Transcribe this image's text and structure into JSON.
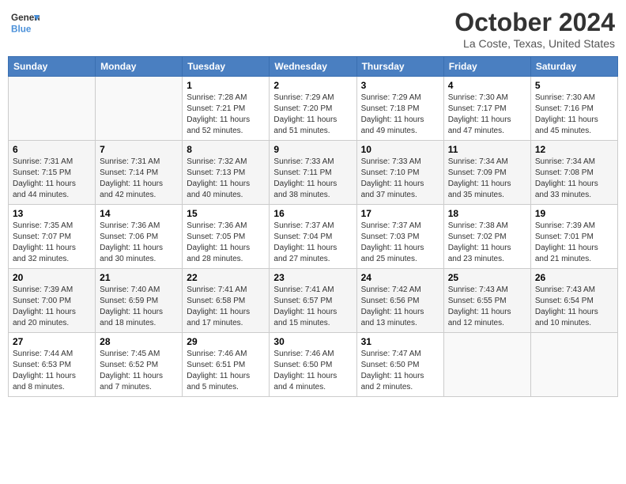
{
  "header": {
    "logo_line1": "General",
    "logo_line2": "Blue",
    "title": "October 2024",
    "subtitle": "La Coste, Texas, United States"
  },
  "days_of_week": [
    "Sunday",
    "Monday",
    "Tuesday",
    "Wednesday",
    "Thursday",
    "Friday",
    "Saturday"
  ],
  "weeks": [
    [
      {
        "day": "",
        "info": ""
      },
      {
        "day": "",
        "info": ""
      },
      {
        "day": "1",
        "info": "Sunrise: 7:28 AM\nSunset: 7:21 PM\nDaylight: 11 hours and 52 minutes."
      },
      {
        "day": "2",
        "info": "Sunrise: 7:29 AM\nSunset: 7:20 PM\nDaylight: 11 hours and 51 minutes."
      },
      {
        "day": "3",
        "info": "Sunrise: 7:29 AM\nSunset: 7:18 PM\nDaylight: 11 hours and 49 minutes."
      },
      {
        "day": "4",
        "info": "Sunrise: 7:30 AM\nSunset: 7:17 PM\nDaylight: 11 hours and 47 minutes."
      },
      {
        "day": "5",
        "info": "Sunrise: 7:30 AM\nSunset: 7:16 PM\nDaylight: 11 hours and 45 minutes."
      }
    ],
    [
      {
        "day": "6",
        "info": "Sunrise: 7:31 AM\nSunset: 7:15 PM\nDaylight: 11 hours and 44 minutes."
      },
      {
        "day": "7",
        "info": "Sunrise: 7:31 AM\nSunset: 7:14 PM\nDaylight: 11 hours and 42 minutes."
      },
      {
        "day": "8",
        "info": "Sunrise: 7:32 AM\nSunset: 7:13 PM\nDaylight: 11 hours and 40 minutes."
      },
      {
        "day": "9",
        "info": "Sunrise: 7:33 AM\nSunset: 7:11 PM\nDaylight: 11 hours and 38 minutes."
      },
      {
        "day": "10",
        "info": "Sunrise: 7:33 AM\nSunset: 7:10 PM\nDaylight: 11 hours and 37 minutes."
      },
      {
        "day": "11",
        "info": "Sunrise: 7:34 AM\nSunset: 7:09 PM\nDaylight: 11 hours and 35 minutes."
      },
      {
        "day": "12",
        "info": "Sunrise: 7:34 AM\nSunset: 7:08 PM\nDaylight: 11 hours and 33 minutes."
      }
    ],
    [
      {
        "day": "13",
        "info": "Sunrise: 7:35 AM\nSunset: 7:07 PM\nDaylight: 11 hours and 32 minutes."
      },
      {
        "day": "14",
        "info": "Sunrise: 7:36 AM\nSunset: 7:06 PM\nDaylight: 11 hours and 30 minutes."
      },
      {
        "day": "15",
        "info": "Sunrise: 7:36 AM\nSunset: 7:05 PM\nDaylight: 11 hours and 28 minutes."
      },
      {
        "day": "16",
        "info": "Sunrise: 7:37 AM\nSunset: 7:04 PM\nDaylight: 11 hours and 27 minutes."
      },
      {
        "day": "17",
        "info": "Sunrise: 7:37 AM\nSunset: 7:03 PM\nDaylight: 11 hours and 25 minutes."
      },
      {
        "day": "18",
        "info": "Sunrise: 7:38 AM\nSunset: 7:02 PM\nDaylight: 11 hours and 23 minutes."
      },
      {
        "day": "19",
        "info": "Sunrise: 7:39 AM\nSunset: 7:01 PM\nDaylight: 11 hours and 21 minutes."
      }
    ],
    [
      {
        "day": "20",
        "info": "Sunrise: 7:39 AM\nSunset: 7:00 PM\nDaylight: 11 hours and 20 minutes."
      },
      {
        "day": "21",
        "info": "Sunrise: 7:40 AM\nSunset: 6:59 PM\nDaylight: 11 hours and 18 minutes."
      },
      {
        "day": "22",
        "info": "Sunrise: 7:41 AM\nSunset: 6:58 PM\nDaylight: 11 hours and 17 minutes."
      },
      {
        "day": "23",
        "info": "Sunrise: 7:41 AM\nSunset: 6:57 PM\nDaylight: 11 hours and 15 minutes."
      },
      {
        "day": "24",
        "info": "Sunrise: 7:42 AM\nSunset: 6:56 PM\nDaylight: 11 hours and 13 minutes."
      },
      {
        "day": "25",
        "info": "Sunrise: 7:43 AM\nSunset: 6:55 PM\nDaylight: 11 hours and 12 minutes."
      },
      {
        "day": "26",
        "info": "Sunrise: 7:43 AM\nSunset: 6:54 PM\nDaylight: 11 hours and 10 minutes."
      }
    ],
    [
      {
        "day": "27",
        "info": "Sunrise: 7:44 AM\nSunset: 6:53 PM\nDaylight: 11 hours and 8 minutes."
      },
      {
        "day": "28",
        "info": "Sunrise: 7:45 AM\nSunset: 6:52 PM\nDaylight: 11 hours and 7 minutes."
      },
      {
        "day": "29",
        "info": "Sunrise: 7:46 AM\nSunset: 6:51 PM\nDaylight: 11 hours and 5 minutes."
      },
      {
        "day": "30",
        "info": "Sunrise: 7:46 AM\nSunset: 6:50 PM\nDaylight: 11 hours and 4 minutes."
      },
      {
        "day": "31",
        "info": "Sunrise: 7:47 AM\nSunset: 6:50 PM\nDaylight: 11 hours and 2 minutes."
      },
      {
        "day": "",
        "info": ""
      },
      {
        "day": "",
        "info": ""
      }
    ]
  ]
}
